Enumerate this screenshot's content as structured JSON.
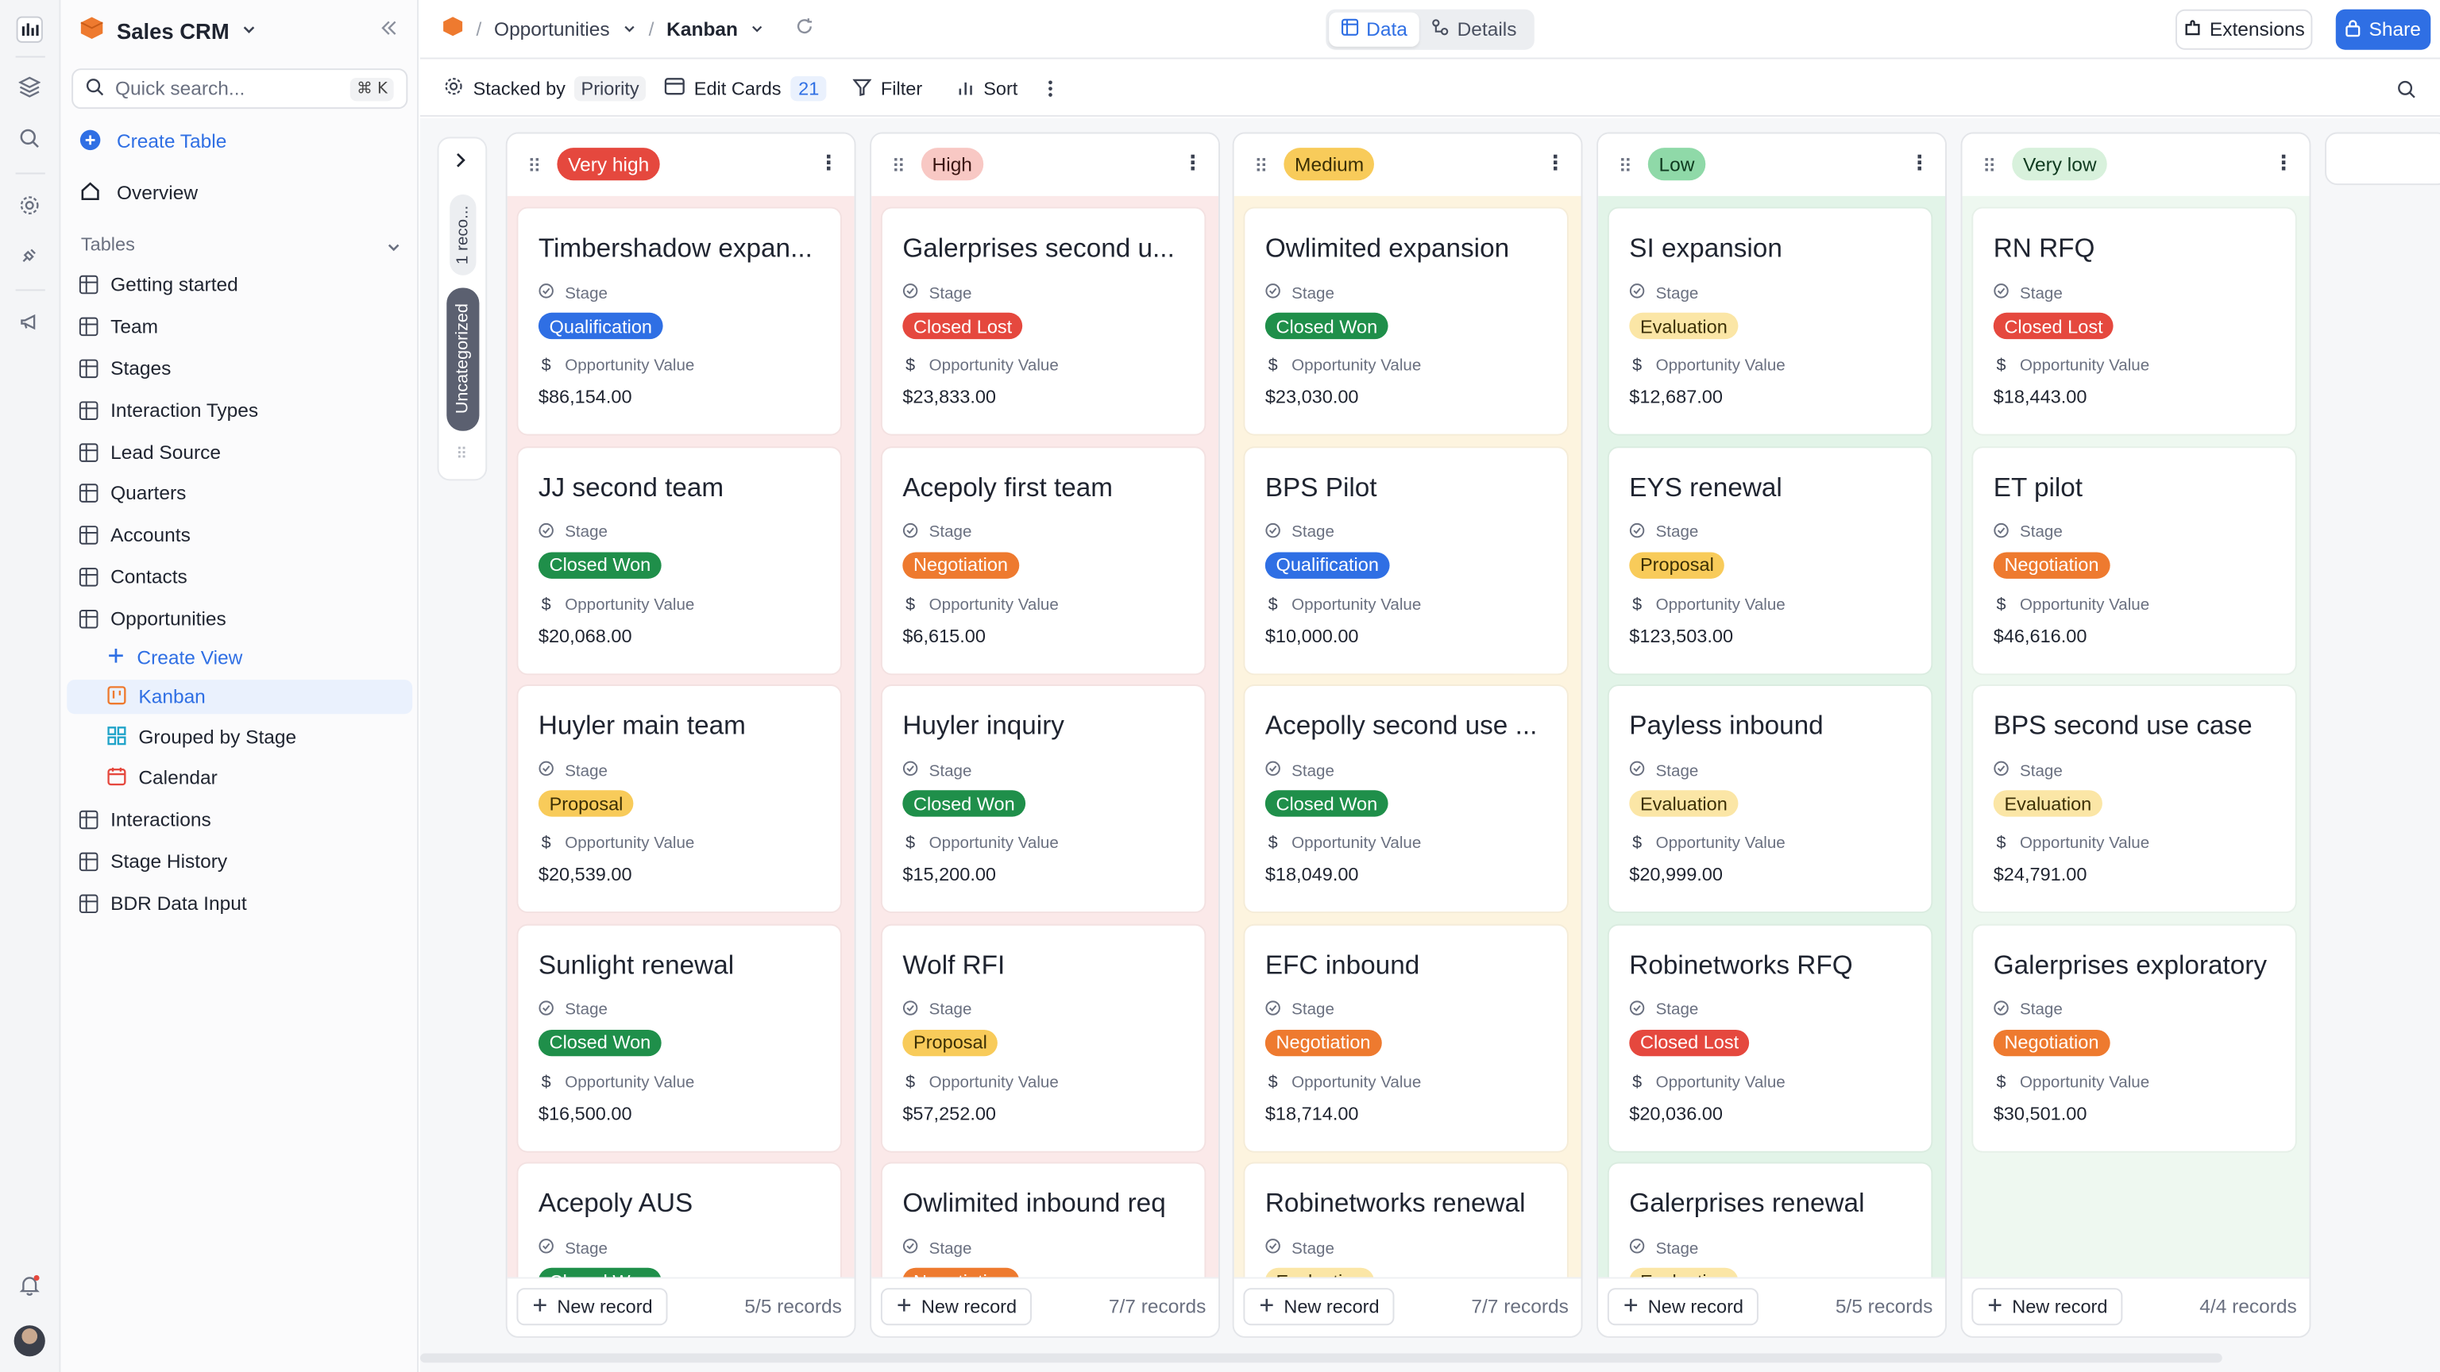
{
  "workspace": {
    "name": "Sales CRM"
  },
  "search": {
    "placeholder": "Quick search...",
    "shortcut": "⌘ K"
  },
  "sidebar": {
    "create_table": "Create Table",
    "overview": "Overview",
    "tables_label": "Tables",
    "tables": [
      "Getting started",
      "Team",
      "Stages",
      "Interaction Types",
      "Lead Source",
      "Quarters",
      "Accounts",
      "Contacts",
      "Opportunities"
    ],
    "create_view": "Create View",
    "views": [
      "Kanban",
      "Grouped by Stage",
      "Calendar"
    ],
    "tables_after": [
      "Interactions",
      "Stage History",
      "BDR Data Input"
    ]
  },
  "breadcrumb": {
    "table": "Opportunities",
    "view": "Kanban"
  },
  "view_toggle": {
    "data": "Data",
    "details": "Details"
  },
  "actions": {
    "extensions": "Extensions",
    "share": "Share"
  },
  "toolbar": {
    "stacked_by": "Stacked by",
    "stacked_field": "Priority",
    "edit_cards": "Edit Cards",
    "edit_cards_count": "21",
    "filter": "Filter",
    "sort": "Sort"
  },
  "uncategorized": {
    "label": "Uncategorized",
    "count": "1 reco..."
  },
  "field_labels": {
    "stage": "Stage",
    "value": "Opportunity Value"
  },
  "new_record": "New record",
  "colors": {
    "accent": "#2f6fe4",
    "stages": {
      "Qualification": {
        "bg": "#2f6fe4",
        "fg": "#ffffff"
      },
      "Closed Lost": {
        "bg": "#e5483e",
        "fg": "#ffffff"
      },
      "Closed Won": {
        "bg": "#1f8f4a",
        "fg": "#ffffff"
      },
      "Evaluation": {
        "bg": "#fbe6a6",
        "fg": "#3b2f05"
      },
      "Negotiation": {
        "bg": "#ee7a2f",
        "fg": "#ffffff"
      },
      "Proposal": {
        "bg": "#f8cb5a",
        "fg": "#3b2f05"
      }
    }
  },
  "columns": [
    {
      "label": "Very high",
      "pill_bg": "#e5483e",
      "pill_fg": "#ffffff",
      "body_bg": "#fbe9e9",
      "records": "5/5 records",
      "cards": [
        {
          "title": "Timbershadow expan...",
          "stage": "Qualification",
          "value": "$86,154.00"
        },
        {
          "title": "JJ second team",
          "stage": "Closed Won",
          "value": "$20,068.00"
        },
        {
          "title": "Huyler main team",
          "stage": "Proposal",
          "value": "$20,539.00"
        },
        {
          "title": "Sunlight renewal",
          "stage": "Closed Won",
          "value": "$16,500.00"
        },
        {
          "title": "Acepoly AUS",
          "stage": "Closed Won",
          "value": ""
        }
      ]
    },
    {
      "label": "High",
      "pill_bg": "#f8c8c4",
      "pill_fg": "#3a1512",
      "body_bg": "#fbe9e9",
      "records": "7/7 records",
      "cards": [
        {
          "title": "Galerprises second u...",
          "stage": "Closed Lost",
          "value": "$23,833.00"
        },
        {
          "title": "Acepoly first team",
          "stage": "Negotiation",
          "value": "$6,615.00"
        },
        {
          "title": "Huyler inquiry",
          "stage": "Closed Won",
          "value": "$15,200.00"
        },
        {
          "title": "Wolf RFI",
          "stage": "Proposal",
          "value": "$57,252.00"
        },
        {
          "title": "Owlimited inbound req",
          "stage": "Negotiation",
          "value": ""
        }
      ]
    },
    {
      "label": "Medium",
      "pill_bg": "#f8cb5a",
      "pill_fg": "#3b2f05",
      "body_bg": "#fdf4df",
      "records": "7/7 records",
      "cards": [
        {
          "title": "Owlimited expansion",
          "stage": "Closed Won",
          "value": "$23,030.00"
        },
        {
          "title": "BPS Pilot",
          "stage": "Qualification",
          "value": "$10,000.00"
        },
        {
          "title": "Acepolly second use ...",
          "stage": "Closed Won",
          "value": "$18,049.00"
        },
        {
          "title": "EFC inbound",
          "stage": "Negotiation",
          "value": "$18,714.00"
        },
        {
          "title": "Robinetworks renewal",
          "stage": "Evaluation",
          "value": ""
        }
      ]
    },
    {
      "label": "Low",
      "pill_bg": "#8fd9a8",
      "pill_fg": "#0f3a1f",
      "body_bg": "#e2f4e8",
      "records": "5/5 records",
      "cards": [
        {
          "title": "SI expansion",
          "stage": "Evaluation",
          "value": "$12,687.00"
        },
        {
          "title": "EYS renewal",
          "stage": "Proposal",
          "value": "$123,503.00"
        },
        {
          "title": "Payless inbound",
          "stage": "Evaluation",
          "value": "$20,999.00"
        },
        {
          "title": "Robinetworks RFQ",
          "stage": "Closed Lost",
          "value": "$20,036.00"
        },
        {
          "title": "Galerprises renewal",
          "stage": "Evaluation",
          "value": ""
        }
      ]
    },
    {
      "label": "Very low",
      "pill_bg": "#d8f1dc",
      "pill_fg": "#0f3a1f",
      "body_bg": "#eef8f0",
      "records": "4/4 records",
      "cards": [
        {
          "title": "RN RFQ",
          "stage": "Closed Lost",
          "value": "$18,443.00"
        },
        {
          "title": "ET pilot",
          "stage": "Negotiation",
          "value": "$46,616.00"
        },
        {
          "title": "BPS second use case",
          "stage": "Evaluation",
          "value": "$24,791.00"
        },
        {
          "title": "Galerprises exploratory",
          "stage": "Negotiation",
          "value": "$30,501.00"
        }
      ]
    }
  ]
}
